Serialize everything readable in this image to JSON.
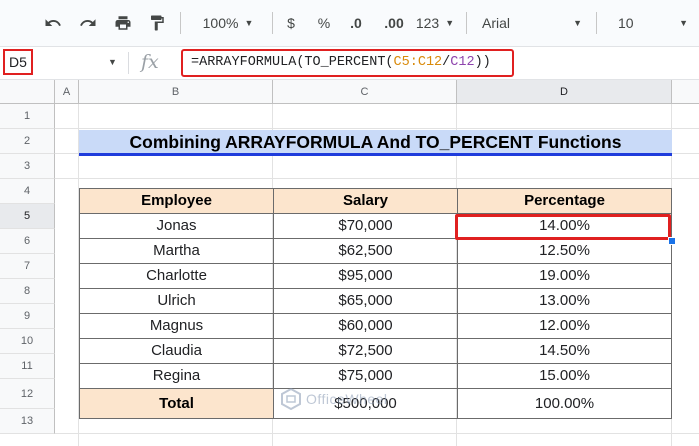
{
  "toolbar": {
    "undo_icon": "undo-icon",
    "redo_icon": "redo-icon",
    "print_icon": "print-icon",
    "paint_format_icon": "paint-format-icon",
    "zoom": "100%",
    "currency": "$",
    "percent": "%",
    "decrease_decimal": ".0",
    "increase_decimal": ".00",
    "more_formats": "123",
    "font": "Arial",
    "font_size": "10"
  },
  "formula_bar": {
    "name_box": "D5",
    "fx": "fx",
    "formula_prefix": "=ARRAYFORMULA(TO_PERCENT(",
    "ref1": "C5:C12",
    "slash": "/",
    "ref2": "C12",
    "formula_suffix": "))"
  },
  "columns": [
    "A",
    "B",
    "C",
    "D"
  ],
  "rows": [
    "1",
    "2",
    "3",
    "4",
    "5",
    "6",
    "7",
    "8",
    "9",
    "10",
    "11",
    "12",
    "13"
  ],
  "sheet": {
    "title": "Combining ARRAYFORMULA And TO_PERCENT Functions",
    "headers": [
      "Employee",
      "Salary",
      "Percentage"
    ],
    "data": [
      [
        "Jonas",
        "$70,000",
        "14.00%"
      ],
      [
        "Martha",
        "$62,500",
        "12.50%"
      ],
      [
        "Charlotte",
        "$95,000",
        "19.00%"
      ],
      [
        "Ulrich",
        "$65,000",
        "13.00%"
      ],
      [
        "Magnus",
        "$60,000",
        "12.00%"
      ],
      [
        "Claudia",
        "$72,500",
        "14.50%"
      ],
      [
        "Regina",
        "$75,000",
        "15.00%"
      ]
    ],
    "total": [
      "Total",
      "$500,000",
      "100.00%"
    ]
  },
  "watermark": "OfficeWheel",
  "colors": {
    "title_fill": "#c9daf8",
    "title_underline": "#1f3cdc",
    "header_fill": "#fce5cd",
    "highlight": "#e02020"
  }
}
